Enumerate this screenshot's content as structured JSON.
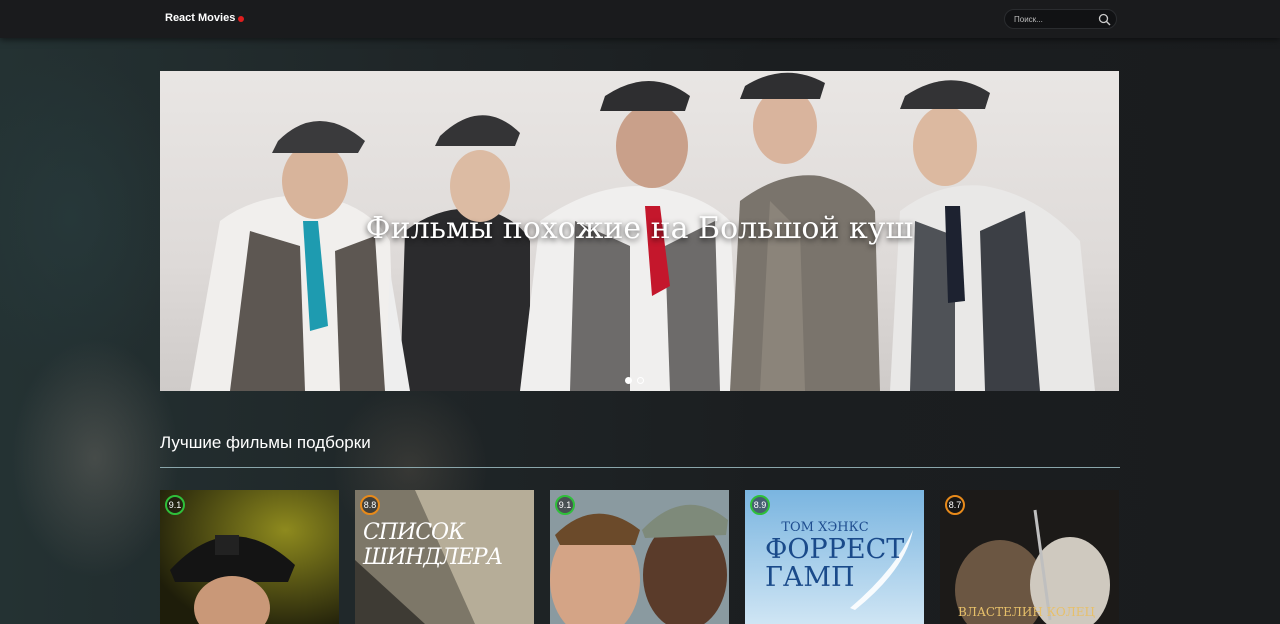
{
  "header": {
    "logo": "React Movies",
    "search_placeholder": "Поиск..."
  },
  "hero": {
    "title": "Фильмы похожие на Большой куш",
    "slides": 2,
    "active_slide": 1
  },
  "section": {
    "title": "Лучшие фильмы подборки"
  },
  "movies": [
    {
      "rating": "9.1",
      "ring": "green",
      "poster_text": ""
    },
    {
      "rating": "8.8",
      "ring": "orange",
      "poster_text": "СПИСОК ШИНДЛЕРА"
    },
    {
      "rating": "9.1",
      "ring": "green",
      "poster_text": ""
    },
    {
      "rating": "8.9",
      "ring": "green",
      "poster_text_top": "ТОМ ХЭНКС",
      "poster_text_main": "ФОРРЕСТ ГАМП"
    },
    {
      "rating": "8.7",
      "ring": "orange",
      "poster_text": "ВЛАСТЕЛИН КОЛЕЦ"
    }
  ],
  "colors": {
    "accent_dot": "#e01e1e",
    "rating_green": "#2fbf3a",
    "rating_orange": "#e88a1a"
  }
}
